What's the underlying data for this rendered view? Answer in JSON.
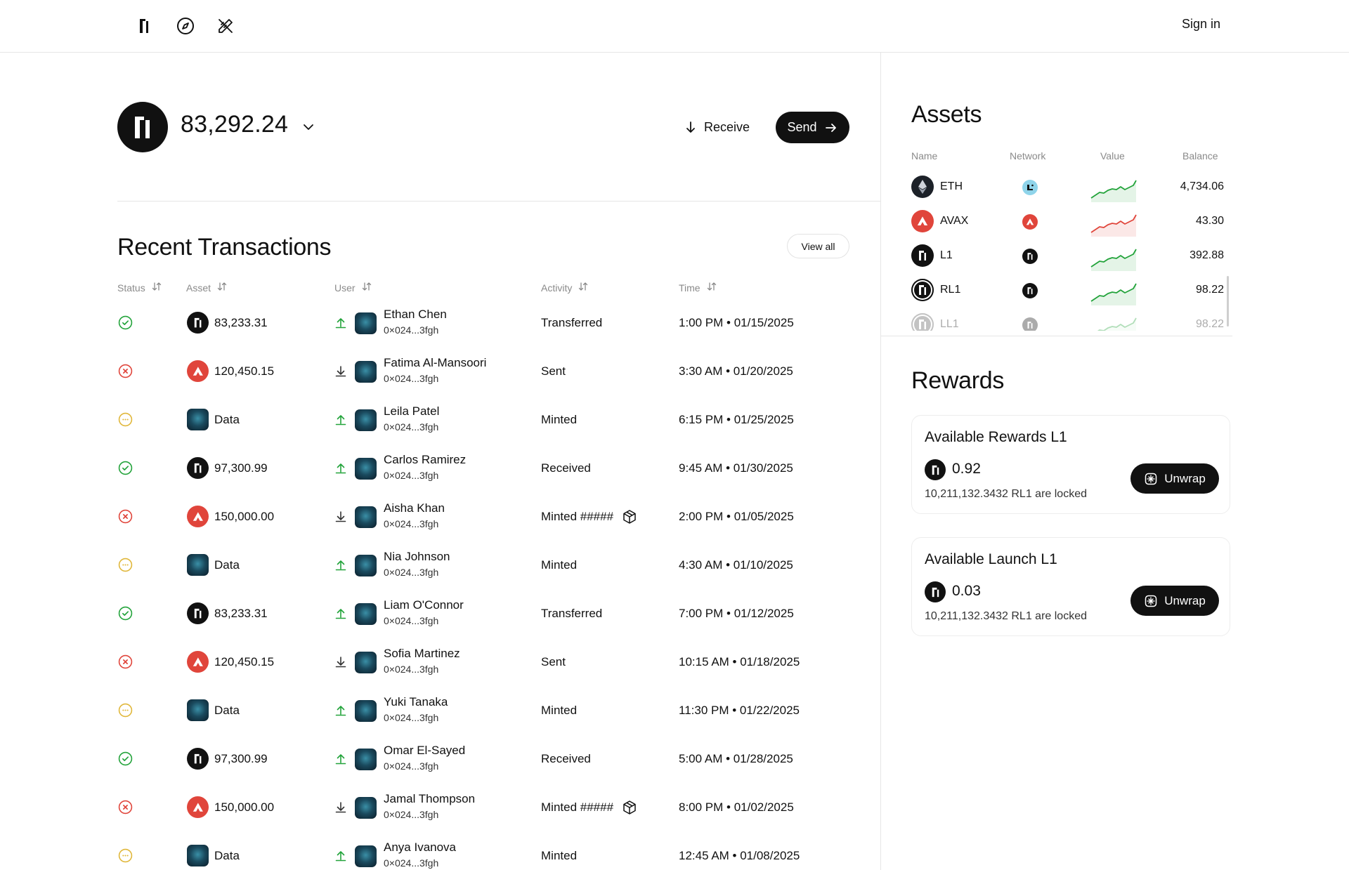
{
  "nav": {
    "signin_label": "Sign in"
  },
  "wallet": {
    "balance": "83,292.24",
    "receive_label": "Receive",
    "send_label": "Send"
  },
  "transactions": {
    "title": "Recent Transactions",
    "view_all_label": "View all",
    "headers": {
      "status": "Status",
      "asset": "Asset",
      "user": "User",
      "activity": "Activity",
      "time": "Time"
    },
    "rows": [
      {
        "status": "success",
        "asset_icon": "l1",
        "asset": "83,233.31",
        "direction": "up",
        "user": "Ethan Chen",
        "address": "0×024...3fgh",
        "activity": "Transferred",
        "badge": false,
        "time": "1:00 PM • 01/15/2025"
      },
      {
        "status": "failed",
        "asset_icon": "avax",
        "asset": "120,450.15",
        "direction": "down",
        "user": "Fatima Al-Mansoori",
        "address": "0×024...3fgh",
        "activity": "Sent",
        "badge": false,
        "time": "3:30 AM • 01/20/2025"
      },
      {
        "status": "pending",
        "asset_icon": "data",
        "asset": "Data",
        "direction": "up",
        "user": "Leila Patel",
        "address": "0×024...3fgh",
        "activity": "Minted",
        "badge": false,
        "time": "6:15 PM • 01/25/2025"
      },
      {
        "status": "success",
        "asset_icon": "l1",
        "asset": "97,300.99",
        "direction": "up",
        "user": "Carlos Ramirez",
        "address": "0×024...3fgh",
        "activity": "Received",
        "badge": false,
        "time": "9:45 AM • 01/30/2025"
      },
      {
        "status": "failed",
        "asset_icon": "avax",
        "asset": "150,000.00",
        "direction": "down",
        "user": "Aisha Khan",
        "address": "0×024...3fgh",
        "activity": "Minted #####",
        "badge": true,
        "time": "2:00 PM • 01/05/2025"
      },
      {
        "status": "pending",
        "asset_icon": "data",
        "asset": "Data",
        "direction": "up",
        "user": "Nia Johnson",
        "address": "0×024...3fgh",
        "activity": "Minted",
        "badge": false,
        "time": "4:30 AM • 01/10/2025"
      },
      {
        "status": "success",
        "asset_icon": "l1",
        "asset": "83,233.31",
        "direction": "up",
        "user": "Liam O'Connor",
        "address": "0×024...3fgh",
        "activity": "Transferred",
        "badge": false,
        "time": "7:00 PM • 01/12/2025"
      },
      {
        "status": "failed",
        "asset_icon": "avax",
        "asset": "120,450.15",
        "direction": "down",
        "user": "Sofia Martinez",
        "address": "0×024...3fgh",
        "activity": "Sent",
        "badge": false,
        "time": "10:15 AM • 01/18/2025"
      },
      {
        "status": "pending",
        "asset_icon": "data",
        "asset": "Data",
        "direction": "up",
        "user": "Yuki Tanaka",
        "address": "0×024...3fgh",
        "activity": "Minted",
        "badge": false,
        "time": "11:30 PM • 01/22/2025"
      },
      {
        "status": "success",
        "asset_icon": "l1",
        "asset": "97,300.99",
        "direction": "up",
        "user": "Omar El-Sayed",
        "address": "0×024...3fgh",
        "activity": "Received",
        "badge": false,
        "time": "5:00 AM • 01/28/2025"
      },
      {
        "status": "failed",
        "asset_icon": "avax",
        "asset": "150,000.00",
        "direction": "down",
        "user": "Jamal Thompson",
        "address": "0×024...3fgh",
        "activity": "Minted #####",
        "badge": true,
        "time": "8:00 PM • 01/02/2025"
      },
      {
        "status": "pending",
        "asset_icon": "data",
        "asset": "Data",
        "direction": "up",
        "user": "Anya Ivanova",
        "address": "0×024...3fgh",
        "activity": "Minted",
        "badge": false,
        "time": "12:45 AM • 01/08/2025"
      }
    ]
  },
  "assets": {
    "title": "Assets",
    "headers": {
      "name": "Name",
      "network": "Network",
      "value": "Value",
      "balance": "Balance"
    },
    "rows": [
      {
        "icon": "eth",
        "name": "ETH",
        "network": "lens",
        "trend": "up",
        "balance": "4,734.06"
      },
      {
        "icon": "avax",
        "name": "AVAX",
        "network": "avax",
        "trend": "up-red",
        "balance": "43.30"
      },
      {
        "icon": "l1",
        "name": "L1",
        "network": "l1",
        "trend": "up",
        "balance": "392.88"
      },
      {
        "icon": "rl1",
        "name": "RL1",
        "network": "l1",
        "trend": "up",
        "balance": "98.22"
      },
      {
        "icon": "ll1",
        "name": "LL1",
        "network": "l1",
        "trend": "up",
        "balance": "98.22"
      }
    ],
    "colors": {
      "up": "#22a33a",
      "down": "#e0453b"
    }
  },
  "rewards": {
    "title": "Rewards",
    "cards": [
      {
        "title": "Available Rewards L1",
        "amount": "0.92",
        "locked": "10,211,132.3432 RL1 are locked",
        "button": "Unwrap"
      },
      {
        "title": "Available Launch L1",
        "amount": "0.03",
        "locked": "10,211,132.3432 RL1 are locked",
        "button": "Unwrap"
      }
    ]
  }
}
